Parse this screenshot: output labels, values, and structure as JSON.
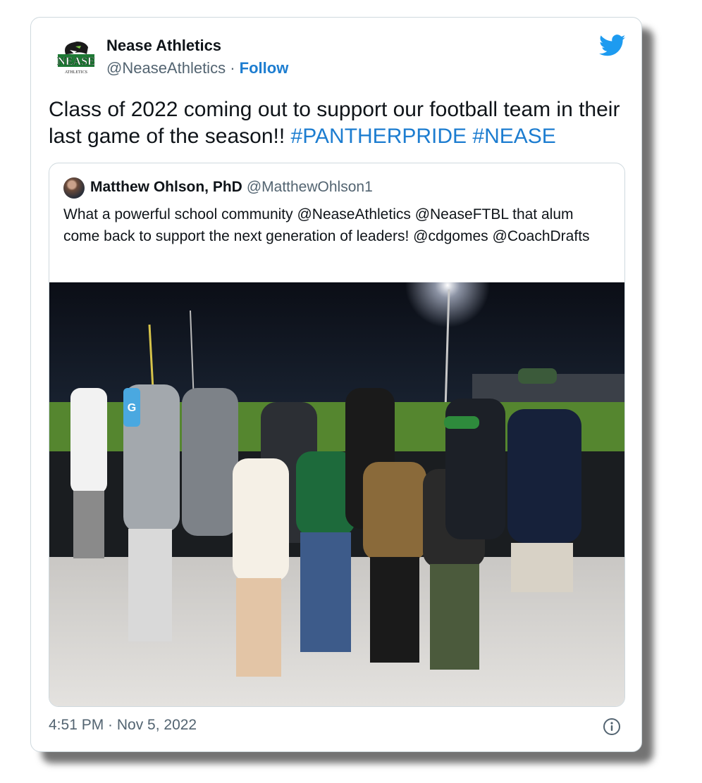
{
  "author": {
    "display_name": "Nease Athletics",
    "handle": "@NeaseAthletics",
    "separator": "·",
    "follow_label": "Follow",
    "logo_text": "NEASE",
    "logo_subtext": "ATHLETICS"
  },
  "tweet": {
    "text": "Class of 2022 coming out to support our football team in their last game of the season!!",
    "hashtags": [
      "#PANTHERPRIDE",
      "#NEASE"
    ]
  },
  "quoted_tweet": {
    "display_name": "Matthew Ohlson, PhD",
    "handle": "@MatthewOhlson1",
    "text": "What a powerful school community @NeaseAthletics @NeaseFTBL that alum come back to support the next generation of leaders! @cdgomes @CoachDrafts"
  },
  "photo_text": {
    "bottle_letter": "G"
  },
  "meta": {
    "timestamp": "4:51 PM · Nov 5, 2022"
  },
  "icons": {
    "brand": "twitter-bird-icon",
    "info": "info-icon"
  },
  "colors": {
    "accent": "#1d9bf0",
    "text": "#0f1419",
    "muted": "#536471",
    "border": "#cfd9de",
    "logo_green": "#1e7a35"
  }
}
